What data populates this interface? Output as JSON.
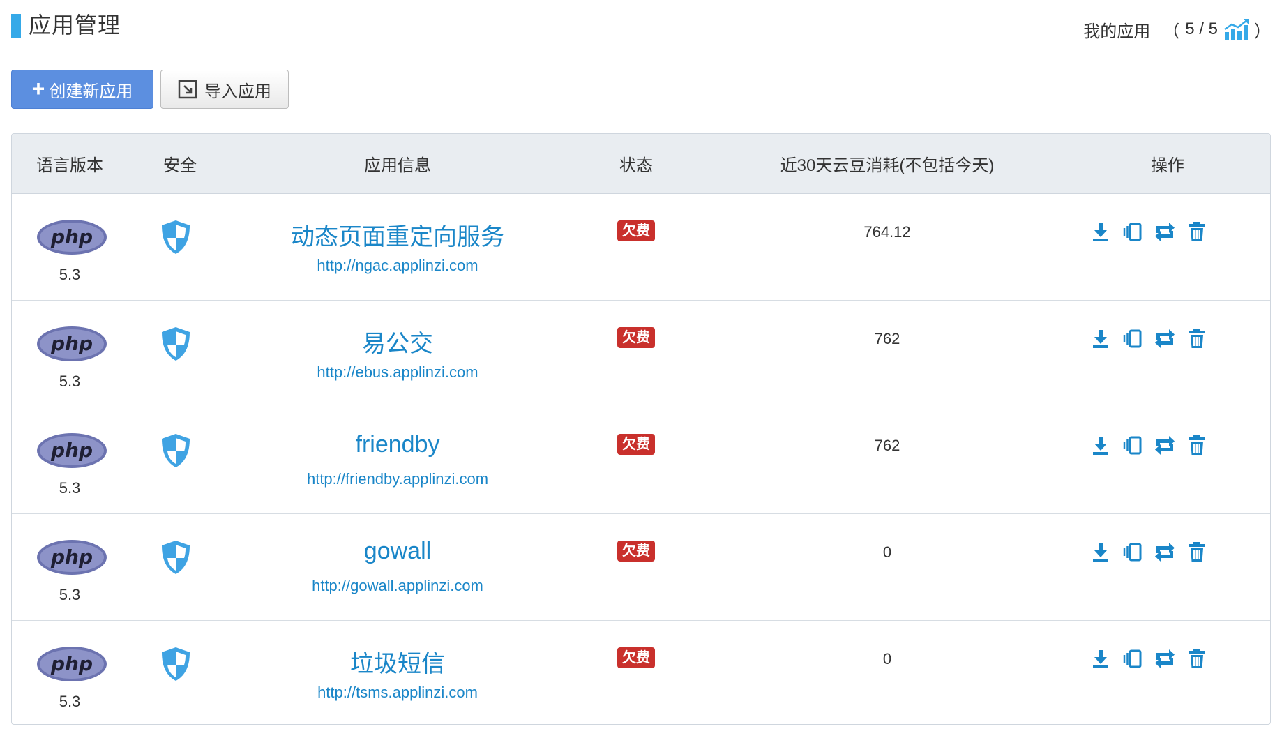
{
  "header": {
    "title": "应用管理",
    "my_apps_label": "我的应用",
    "open_paren": "（",
    "count": "5 / 5",
    "close_paren": "）"
  },
  "toolbar": {
    "create_label": "创建新应用",
    "import_label": "导入应用"
  },
  "table": {
    "columns": {
      "lang": "语言版本",
      "security": "安全",
      "info": "应用信息",
      "status": "状态",
      "usage": "近30天云豆消耗(不包括今天)",
      "ops": "操作"
    },
    "rows": [
      {
        "lang_logo": "php",
        "version": "5.3",
        "name": "动态页面重定向服务",
        "url": "http://ngac.applinzi.com",
        "status": "欠费",
        "usage": "764.12"
      },
      {
        "lang_logo": "php",
        "version": "5.3",
        "name": "易公交",
        "url": "http://ebus.applinzi.com",
        "status": "欠费",
        "usage": "762"
      },
      {
        "lang_logo": "php",
        "version": "5.3",
        "name": "friendby",
        "url": "http://friendby.applinzi.com",
        "status": "欠费",
        "usage": "762"
      },
      {
        "lang_logo": "php",
        "version": "5.3",
        "name": "gowall",
        "url": "http://gowall.applinzi.com",
        "status": "欠费",
        "usage": "0"
      },
      {
        "lang_logo": "php",
        "version": "5.3",
        "name": "垃圾短信",
        "url": "http://tsms.applinzi.com",
        "status": "欠费",
        "usage": "0"
      }
    ]
  },
  "icons": {
    "security": "shield-icon",
    "ops": [
      "download-icon",
      "vibrate-icon",
      "sync-icon",
      "trash-icon"
    ],
    "header_stats": "chart-up-icon",
    "import": "import-icon"
  },
  "colors": {
    "accent": "#35a9e8",
    "link": "#1a86c8",
    "primary_button": "#5c8fe0",
    "badge_danger": "#c9302c",
    "table_header_bg": "#e9edf1"
  }
}
